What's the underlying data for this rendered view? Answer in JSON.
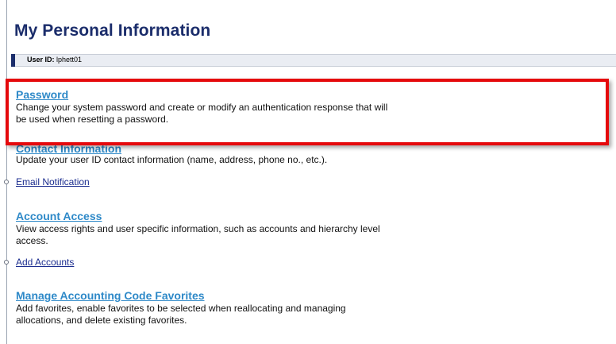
{
  "page": {
    "title": "My Personal Information"
  },
  "user": {
    "label": "User ID:",
    "value": "lphett01"
  },
  "sections": {
    "password": {
      "link": "Password",
      "description": "Change your system password and create or modify an authentication response that will\nbe used when resetting a password."
    },
    "contact": {
      "link": "Contact Information",
      "description": "Update your user ID contact information (name, address, phone no., etc.).",
      "sublink": "Email Notification"
    },
    "account_access": {
      "link": "Account Access",
      "description": "View access rights and user specific information, such as accounts and hierarchy level\naccess.",
      "sublink": "Add Accounts"
    },
    "accounting_codes": {
      "link": "Manage Accounting Code Favorites",
      "description": "Add favorites, enable favorites to be selected when reallocating and managing\nallocations, and delete existing favorites."
    }
  },
  "colors": {
    "title": "#1b2d6b",
    "section_link": "#2e89c8",
    "sublink": "#1b2d8f",
    "highlight": "#e5090c"
  }
}
